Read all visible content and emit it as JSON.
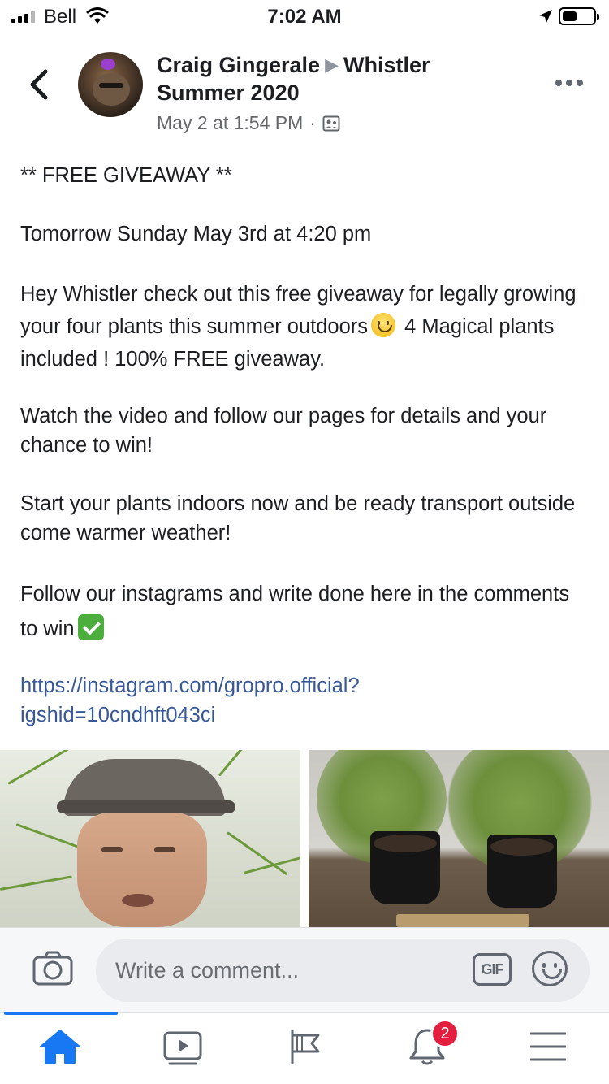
{
  "status_bar": {
    "carrier": "Bell",
    "time": "7:02 AM",
    "battery_fraction": 0.45
  },
  "post": {
    "author": "Craig Gingerale",
    "group": "Whistler Summer 2020",
    "timestamp": "May 2 at 1:54 PM",
    "separator": "·",
    "audience_icon": "group-members-icon",
    "body": {
      "heading": "** FREE GIVEAWAY **",
      "date_line": "Tomorrow Sunday May 3rd at 4:20 pm",
      "p1_a": "Hey Whistler check out this free giveaway for legally growing your four plants this summer outdoors",
      "p1_b": "4 Magical plants included ! 100% FREE giveaway.",
      "p2": "Watch the video and follow our pages for details and your chance to win!",
      "p3": "Start your plants indoors now and be ready transport outside come warmer weather!",
      "p4": "Follow our instagrams and write done here in the comments to win",
      "link_line1": "https://instagram.com/gropro.official?",
      "link_line2": "igshid=10cndhft043ci"
    },
    "emojis": [
      "slightly-smiling-face",
      "white-check-mark"
    ]
  },
  "comment_bar": {
    "placeholder": "Write a comment...",
    "gif_label": "GIF"
  },
  "tab_bar": {
    "tabs": [
      "home",
      "watch",
      "pages",
      "notifications",
      "menu"
    ],
    "active": "home",
    "notifications_badge": "2"
  },
  "colors": {
    "accent": "#1877f2",
    "link": "#385898",
    "badge": "#e41e3f",
    "secondary_text": "#65676b"
  }
}
